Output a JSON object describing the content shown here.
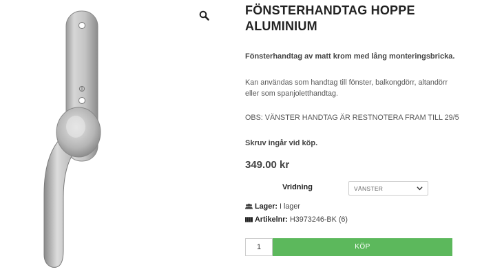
{
  "product": {
    "title": "FÖNSTERHANDTAG HOPPE ALUMINIUM",
    "description_strong": "Fönsterhandtag av matt krom med lång monteringsbricka.",
    "description": "Kan användas som handtag till fönster, balkongdörr, altandörr eller som spanjoletthandtag.",
    "notice": "OBS: VÄNSTER HANDTAG ÄR RESTNOTERA FRAM TILL 29/5",
    "screws": "Skruv ingår vid köp.",
    "price": "349.00 kr"
  },
  "variation": {
    "label": "Vridning",
    "selected": "VÄNSTER"
  },
  "meta": {
    "stock_label": "Lager:",
    "stock_value": "I lager",
    "sku_label": "Artikelnr:",
    "sku_value": "H3973246-BK (6)"
  },
  "cart": {
    "quantity": "1",
    "buy_label": "KÖP"
  },
  "icons": {
    "zoom": "magnifier-icon",
    "dropdown": "chevron-down-icon",
    "stock": "users-icon",
    "sku": "barcode-icon"
  },
  "colors": {
    "buy_button": "#5cb85c",
    "title": "#222222"
  }
}
